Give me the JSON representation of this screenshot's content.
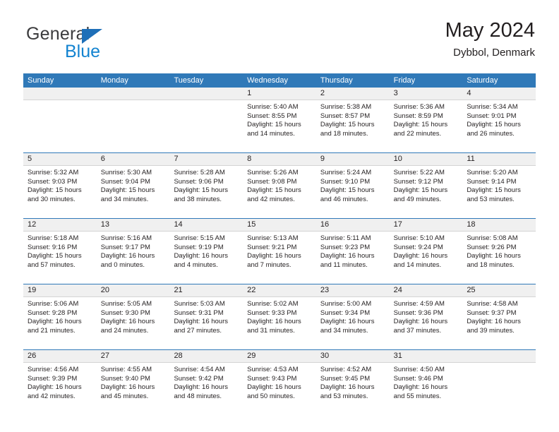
{
  "brand": {
    "name_top": "General",
    "name_bottom": "Blue",
    "color_dark": "#3b3b3d",
    "color_blue": "#1383d0"
  },
  "header": {
    "title": "May 2024",
    "subtitle": "Dybbol, Denmark"
  },
  "theme": {
    "header_row_bg": "#3079b8",
    "daynum_band_bg": "#f0f0f0",
    "week_separator": "#3079b8",
    "text": "#231f20"
  },
  "weekday_headers": [
    "Sunday",
    "Monday",
    "Tuesday",
    "Wednesday",
    "Thursday",
    "Friday",
    "Saturday"
  ],
  "weeks": [
    [
      {
        "day": "",
        "lines": []
      },
      {
        "day": "",
        "lines": []
      },
      {
        "day": "",
        "lines": []
      },
      {
        "day": "1",
        "lines": [
          "Sunrise: 5:40 AM",
          "Sunset: 8:55 PM",
          "Daylight: 15 hours",
          "and 14 minutes."
        ]
      },
      {
        "day": "2",
        "lines": [
          "Sunrise: 5:38 AM",
          "Sunset: 8:57 PM",
          "Daylight: 15 hours",
          "and 18 minutes."
        ]
      },
      {
        "day": "3",
        "lines": [
          "Sunrise: 5:36 AM",
          "Sunset: 8:59 PM",
          "Daylight: 15 hours",
          "and 22 minutes."
        ]
      },
      {
        "day": "4",
        "lines": [
          "Sunrise: 5:34 AM",
          "Sunset: 9:01 PM",
          "Daylight: 15 hours",
          "and 26 minutes."
        ]
      }
    ],
    [
      {
        "day": "5",
        "lines": [
          "Sunrise: 5:32 AM",
          "Sunset: 9:03 PM",
          "Daylight: 15 hours",
          "and 30 minutes."
        ]
      },
      {
        "day": "6",
        "lines": [
          "Sunrise: 5:30 AM",
          "Sunset: 9:04 PM",
          "Daylight: 15 hours",
          "and 34 minutes."
        ]
      },
      {
        "day": "7",
        "lines": [
          "Sunrise: 5:28 AM",
          "Sunset: 9:06 PM",
          "Daylight: 15 hours",
          "and 38 minutes."
        ]
      },
      {
        "day": "8",
        "lines": [
          "Sunrise: 5:26 AM",
          "Sunset: 9:08 PM",
          "Daylight: 15 hours",
          "and 42 minutes."
        ]
      },
      {
        "day": "9",
        "lines": [
          "Sunrise: 5:24 AM",
          "Sunset: 9:10 PM",
          "Daylight: 15 hours",
          "and 46 minutes."
        ]
      },
      {
        "day": "10",
        "lines": [
          "Sunrise: 5:22 AM",
          "Sunset: 9:12 PM",
          "Daylight: 15 hours",
          "and 49 minutes."
        ]
      },
      {
        "day": "11",
        "lines": [
          "Sunrise: 5:20 AM",
          "Sunset: 9:14 PM",
          "Daylight: 15 hours",
          "and 53 minutes."
        ]
      }
    ],
    [
      {
        "day": "12",
        "lines": [
          "Sunrise: 5:18 AM",
          "Sunset: 9:16 PM",
          "Daylight: 15 hours",
          "and 57 minutes."
        ]
      },
      {
        "day": "13",
        "lines": [
          "Sunrise: 5:16 AM",
          "Sunset: 9:17 PM",
          "Daylight: 16 hours",
          "and 0 minutes."
        ]
      },
      {
        "day": "14",
        "lines": [
          "Sunrise: 5:15 AM",
          "Sunset: 9:19 PM",
          "Daylight: 16 hours",
          "and 4 minutes."
        ]
      },
      {
        "day": "15",
        "lines": [
          "Sunrise: 5:13 AM",
          "Sunset: 9:21 PM",
          "Daylight: 16 hours",
          "and 7 minutes."
        ]
      },
      {
        "day": "16",
        "lines": [
          "Sunrise: 5:11 AM",
          "Sunset: 9:23 PM",
          "Daylight: 16 hours",
          "and 11 minutes."
        ]
      },
      {
        "day": "17",
        "lines": [
          "Sunrise: 5:10 AM",
          "Sunset: 9:24 PM",
          "Daylight: 16 hours",
          "and 14 minutes."
        ]
      },
      {
        "day": "18",
        "lines": [
          "Sunrise: 5:08 AM",
          "Sunset: 9:26 PM",
          "Daylight: 16 hours",
          "and 18 minutes."
        ]
      }
    ],
    [
      {
        "day": "19",
        "lines": [
          "Sunrise: 5:06 AM",
          "Sunset: 9:28 PM",
          "Daylight: 16 hours",
          "and 21 minutes."
        ]
      },
      {
        "day": "20",
        "lines": [
          "Sunrise: 5:05 AM",
          "Sunset: 9:30 PM",
          "Daylight: 16 hours",
          "and 24 minutes."
        ]
      },
      {
        "day": "21",
        "lines": [
          "Sunrise: 5:03 AM",
          "Sunset: 9:31 PM",
          "Daylight: 16 hours",
          "and 27 minutes."
        ]
      },
      {
        "day": "22",
        "lines": [
          "Sunrise: 5:02 AM",
          "Sunset: 9:33 PM",
          "Daylight: 16 hours",
          "and 31 minutes."
        ]
      },
      {
        "day": "23",
        "lines": [
          "Sunrise: 5:00 AM",
          "Sunset: 9:34 PM",
          "Daylight: 16 hours",
          "and 34 minutes."
        ]
      },
      {
        "day": "24",
        "lines": [
          "Sunrise: 4:59 AM",
          "Sunset: 9:36 PM",
          "Daylight: 16 hours",
          "and 37 minutes."
        ]
      },
      {
        "day": "25",
        "lines": [
          "Sunrise: 4:58 AM",
          "Sunset: 9:37 PM",
          "Daylight: 16 hours",
          "and 39 minutes."
        ]
      }
    ],
    [
      {
        "day": "26",
        "lines": [
          "Sunrise: 4:56 AM",
          "Sunset: 9:39 PM",
          "Daylight: 16 hours",
          "and 42 minutes."
        ]
      },
      {
        "day": "27",
        "lines": [
          "Sunrise: 4:55 AM",
          "Sunset: 9:40 PM",
          "Daylight: 16 hours",
          "and 45 minutes."
        ]
      },
      {
        "day": "28",
        "lines": [
          "Sunrise: 4:54 AM",
          "Sunset: 9:42 PM",
          "Daylight: 16 hours",
          "and 48 minutes."
        ]
      },
      {
        "day": "29",
        "lines": [
          "Sunrise: 4:53 AM",
          "Sunset: 9:43 PM",
          "Daylight: 16 hours",
          "and 50 minutes."
        ]
      },
      {
        "day": "30",
        "lines": [
          "Sunrise: 4:52 AM",
          "Sunset: 9:45 PM",
          "Daylight: 16 hours",
          "and 53 minutes."
        ]
      },
      {
        "day": "31",
        "lines": [
          "Sunrise: 4:50 AM",
          "Sunset: 9:46 PM",
          "Daylight: 16 hours",
          "and 55 minutes."
        ]
      },
      {
        "day": "",
        "lines": []
      }
    ]
  ]
}
